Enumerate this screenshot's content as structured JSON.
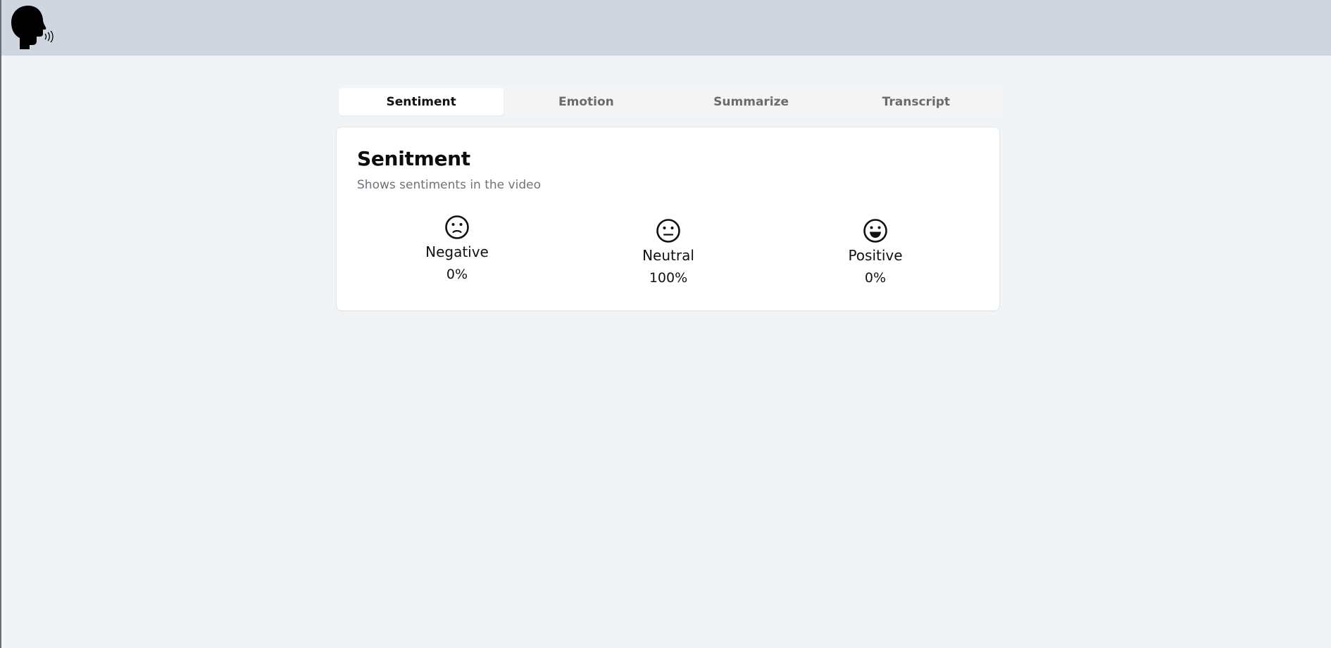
{
  "header": {
    "logo_icon": "speaking-head-icon"
  },
  "tabs": [
    {
      "label": "Sentiment",
      "active": true
    },
    {
      "label": "Emotion",
      "active": false
    },
    {
      "label": "Summarize",
      "active": false
    },
    {
      "label": "Transcript",
      "active": false
    }
  ],
  "card": {
    "title": "Senitment",
    "subtitle": "Shows sentiments in the video"
  },
  "sentiments": [
    {
      "label": "Negative",
      "value": "0%",
      "icon": "slightly-frowning-face-icon"
    },
    {
      "label": "Neutral",
      "value": "100%",
      "icon": "neutral-face-icon"
    },
    {
      "label": "Positive",
      "value": "0%",
      "icon": "grinning-face-icon"
    }
  ],
  "colors": {
    "topbar": "#cfd6e0",
    "page_bg": "#f1f4f7",
    "card_bg": "#ffffff",
    "active_tab_bg": "#ffffff",
    "tab_strip_bg": "#f4f4f5",
    "muted_text": "#71717a"
  }
}
